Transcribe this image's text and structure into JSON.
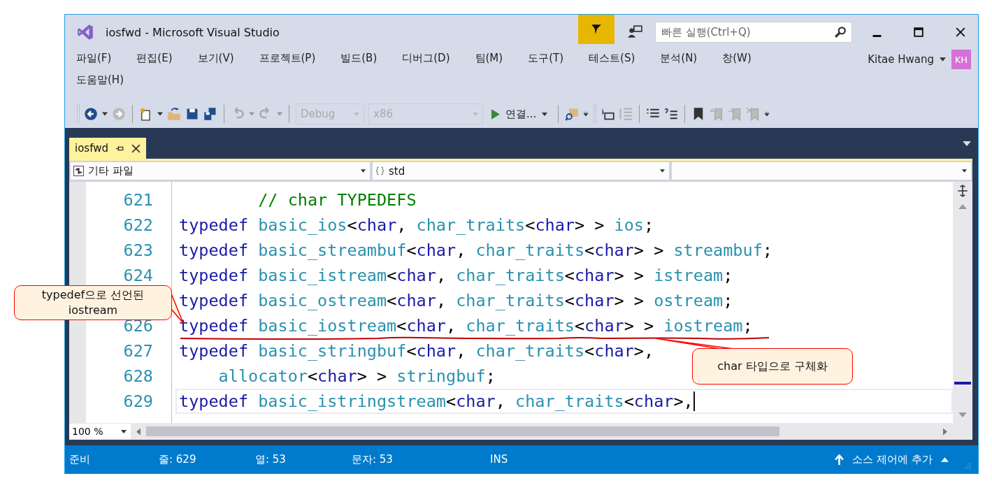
{
  "window": {
    "title": "iosfwd - Microsoft Visual Studio"
  },
  "quick_launch": {
    "placeholder": "빠른 실행(Ctrl+Q)"
  },
  "account": {
    "name": "Kitae Hwang",
    "initials": "KH"
  },
  "menu": [
    "파일(F)",
    "편집(E)",
    "보기(V)",
    "프로젝트(P)",
    "빌드(B)",
    "디버그(D)",
    "팀(M)",
    "도구(T)",
    "테스트(S)",
    "분석(N)",
    "창(W)",
    "도움말(H)"
  ],
  "toolbar": {
    "configuration": "Debug",
    "platform": "x86",
    "run": "연결..."
  },
  "tabs": [
    {
      "label": "iosfwd",
      "selected": true
    }
  ],
  "navigation": {
    "project": "기타 파일",
    "scope": "std"
  },
  "code": [
    {
      "number": "621",
      "current": false,
      "tokens": [
        {
          "kind": "comment",
          "text": "        // char TYPEDEFS"
        }
      ]
    },
    {
      "number": "622",
      "current": false,
      "tokens": [
        {
          "kind": "keyword",
          "text": "typedef "
        },
        {
          "kind": "type",
          "text": "basic_ios"
        },
        {
          "kind": "plain",
          "text": "<"
        },
        {
          "kind": "keyword",
          "text": "char"
        },
        {
          "kind": "plain",
          "text": ", "
        },
        {
          "kind": "type",
          "text": "char_traits"
        },
        {
          "kind": "plain",
          "text": "<"
        },
        {
          "kind": "keyword",
          "text": "char"
        },
        {
          "kind": "plain",
          "text": "> > "
        },
        {
          "kind": "type",
          "text": "ios"
        },
        {
          "kind": "plain",
          "text": ";"
        }
      ]
    },
    {
      "number": "623",
      "current": false,
      "tokens": [
        {
          "kind": "keyword",
          "text": "typedef "
        },
        {
          "kind": "type",
          "text": "basic_streambuf"
        },
        {
          "kind": "plain",
          "text": "<"
        },
        {
          "kind": "keyword",
          "text": "char"
        },
        {
          "kind": "plain",
          "text": ", "
        },
        {
          "kind": "type",
          "text": "char_traits"
        },
        {
          "kind": "plain",
          "text": "<"
        },
        {
          "kind": "keyword",
          "text": "char"
        },
        {
          "kind": "plain",
          "text": "> > "
        },
        {
          "kind": "type",
          "text": "streambuf"
        },
        {
          "kind": "plain",
          "text": ";"
        }
      ]
    },
    {
      "number": "624",
      "current": false,
      "tokens": [
        {
          "kind": "keyword",
          "text": "typedef "
        },
        {
          "kind": "type",
          "text": "basic_istream"
        },
        {
          "kind": "plain",
          "text": "<"
        },
        {
          "kind": "keyword",
          "text": "char"
        },
        {
          "kind": "plain",
          "text": ", "
        },
        {
          "kind": "type",
          "text": "char_traits"
        },
        {
          "kind": "plain",
          "text": "<"
        },
        {
          "kind": "keyword",
          "text": "char"
        },
        {
          "kind": "plain",
          "text": "> > "
        },
        {
          "kind": "type",
          "text": "istream"
        },
        {
          "kind": "plain",
          "text": ";"
        }
      ]
    },
    {
      "current": false,
      "tokens": [
        {
          "kind": "keyword",
          "text": "typedef "
        },
        {
          "kind": "type",
          "text": "basic_ostream"
        },
        {
          "kind": "plain",
          "text": "<"
        },
        {
          "kind": "keyword",
          "text": "char"
        },
        {
          "kind": "plain",
          "text": ", "
        },
        {
          "kind": "type",
          "text": "char_traits"
        },
        {
          "kind": "plain",
          "text": "<"
        },
        {
          "kind": "keyword",
          "text": "char"
        },
        {
          "kind": "plain",
          "text": "> > "
        },
        {
          "kind": "type",
          "text": "ostream"
        },
        {
          "kind": "plain",
          "text": ";"
        }
      ]
    },
    {
      "number": "626",
      "current": false,
      "tokens": [
        {
          "kind": "keyword",
          "text": "typedef "
        },
        {
          "kind": "type",
          "text": "basic_iostream"
        },
        {
          "kind": "plain",
          "text": "<"
        },
        {
          "kind": "keyword",
          "text": "char"
        },
        {
          "kind": "plain",
          "text": ", "
        },
        {
          "kind": "type",
          "text": "char_traits"
        },
        {
          "kind": "plain",
          "text": "<"
        },
        {
          "kind": "keyword",
          "text": "char"
        },
        {
          "kind": "plain",
          "text": "> > "
        },
        {
          "kind": "type",
          "text": "iostream"
        },
        {
          "kind": "plain",
          "text": ";"
        }
      ]
    },
    {
      "number": "627",
      "current": false,
      "tokens": [
        {
          "kind": "keyword",
          "text": "typedef "
        },
        {
          "kind": "type",
          "text": "basic_stringbuf"
        },
        {
          "kind": "plain",
          "text": "<"
        },
        {
          "kind": "keyword",
          "text": "char"
        },
        {
          "kind": "plain",
          "text": ", "
        },
        {
          "kind": "type",
          "text": "char_traits"
        },
        {
          "kind": "plain",
          "text": "<"
        },
        {
          "kind": "keyword",
          "text": "char"
        },
        {
          "kind": "plain",
          "text": ">,"
        }
      ]
    },
    {
      "number": "628",
      "current": false,
      "tokens": [
        {
          "kind": "type",
          "text": "    allocator"
        },
        {
          "kind": "plain",
          "text": "<"
        },
        {
          "kind": "keyword",
          "text": "char"
        },
        {
          "kind": "plain",
          "text": "> > "
        },
        {
          "kind": "type",
          "text": "stringbuf"
        },
        {
          "kind": "plain",
          "text": ";"
        }
      ]
    },
    {
      "number": "629",
      "current": true,
      "tokens": [
        {
          "kind": "keyword",
          "text": "typedef "
        },
        {
          "kind": "type",
          "text": "basic_istringstream"
        },
        {
          "kind": "plain",
          "text": "<"
        },
        {
          "kind": "keyword",
          "text": "char"
        },
        {
          "kind": "plain",
          "text": ", "
        },
        {
          "kind": "type",
          "text": "char_traits"
        },
        {
          "kind": "plain",
          "text": "<"
        },
        {
          "kind": "keyword",
          "text": "char"
        },
        {
          "kind": "plain",
          "text": ">,"
        }
      ]
    }
  ],
  "zoom": "100 %",
  "status_bar": [
    {
      "kind": "state",
      "text": "준비"
    },
    {
      "kind": "field",
      "text": "줄: 629"
    },
    {
      "kind": "field",
      "text": "열: 53"
    },
    {
      "kind": "field",
      "text": "문자: 53"
    },
    {
      "kind": "mode",
      "text": "INS"
    }
  ],
  "source_control": "소스 제어에 추가",
  "callouts": [
    {
      "text": "typedef으로 선언된 iostream"
    },
    {
      "text": "char 타입으로 구체화"
    }
  ]
}
